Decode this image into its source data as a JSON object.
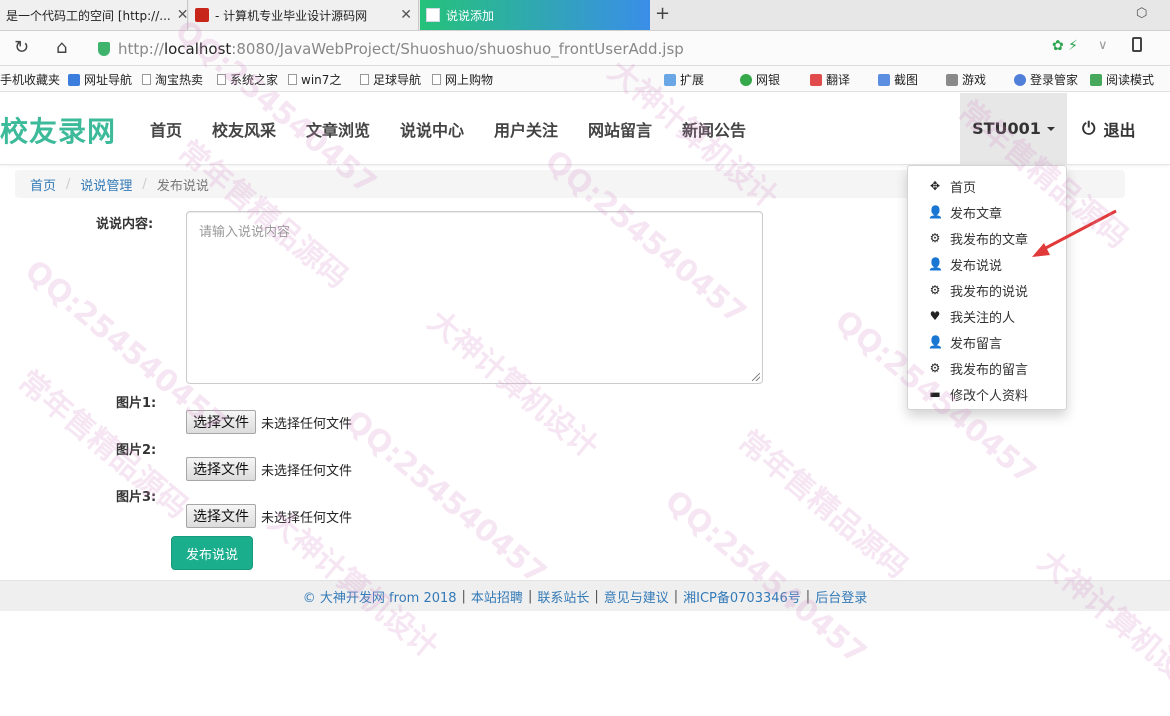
{
  "browser": {
    "tabs": [
      {
        "title": "是一个代码工的空间 [http://..."
      },
      {
        "title": "- 计算机专业毕业设计源码网"
      },
      {
        "title": "说说添加"
      }
    ],
    "url_prefix": "http://",
    "url_host": "localhost",
    "url_rest": ":8080/JavaWebProject/Shuoshuo/shuoshuo_frontUserAdd.jsp",
    "bookmarks": [
      "手机收藏夹",
      "网址导航",
      "淘宝热卖",
      "系统之家",
      "win7之",
      "足球导航",
      "网上购物"
    ],
    "toolbar_right": [
      "扩展",
      "网银",
      "翻译",
      "截图",
      "游戏",
      "登录管家",
      "阅读模式"
    ]
  },
  "site": {
    "brand": "校友录网",
    "nav": [
      "首页",
      "校友风采",
      "文章浏览",
      "说说中心",
      "用户关注",
      "网站留言",
      "新闻公告"
    ],
    "user": "STU001",
    "logout": "退出"
  },
  "breadcrumb": {
    "home": "首页",
    "section": "说说管理",
    "current": "发布说说"
  },
  "form": {
    "content_label": "说说内容:",
    "content_placeholder": "请输入说说内容",
    "images": [
      {
        "label": "图片1:",
        "button": "选择文件",
        "status": "未选择任何文件"
      },
      {
        "label": "图片2:",
        "button": "选择文件",
        "status": "未选择任何文件"
      },
      {
        "label": "图片3:",
        "button": "选择文件",
        "status": "未选择任何文件"
      }
    ],
    "submit": "发布说说"
  },
  "footer": {
    "copyright": "© 大神开发网 from 2018",
    "links": [
      "本站招聘",
      "联系站长",
      "意见与建议",
      "湘ICP备0703346号",
      "后台登录"
    ]
  },
  "dropdown": [
    {
      "icon": "move-icon",
      "label": "首页"
    },
    {
      "icon": "user-icon",
      "label": "发布文章"
    },
    {
      "icon": "gear-icon",
      "label": "我发布的文章"
    },
    {
      "icon": "user-icon",
      "label": "发布说说"
    },
    {
      "icon": "gear-icon",
      "label": "我发布的说说"
    },
    {
      "icon": "heart-icon",
      "label": "我关注的人"
    },
    {
      "icon": "user-icon",
      "label": "发布留言"
    },
    {
      "icon": "gear-icon",
      "label": "我发布的留言"
    },
    {
      "icon": "card-icon",
      "label": "修改个人资料"
    }
  ],
  "watermark": [
    "QQ:254540457",
    "大神计算机设计",
    "常年售精品源码"
  ],
  "colors": {
    "brand": "#3cba9a",
    "button": "#1aae8d",
    "link": "#337ab7",
    "tab_active_start": "#25c27a",
    "tab_active_end": "#3a8ee8"
  }
}
